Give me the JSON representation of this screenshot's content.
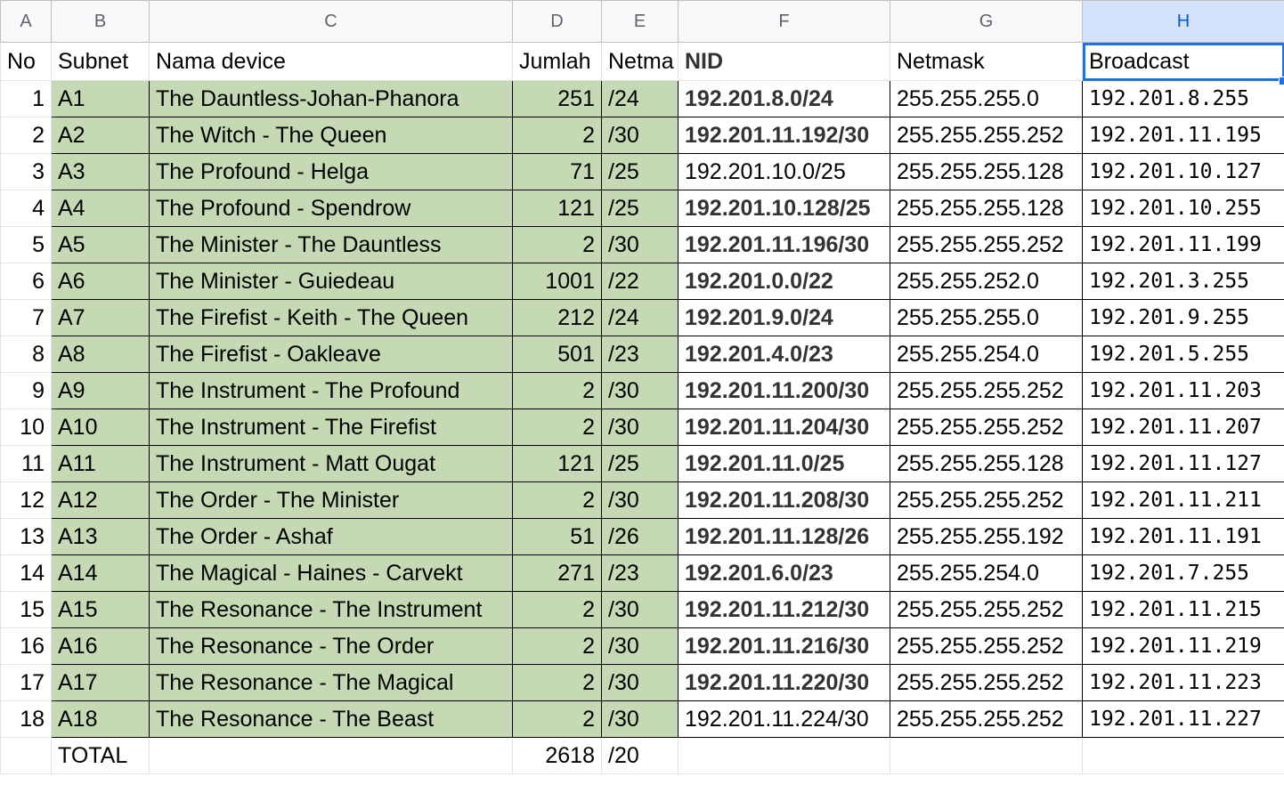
{
  "columns": [
    "A",
    "B",
    "C",
    "D",
    "E",
    "F",
    "G",
    "H"
  ],
  "header_row": {
    "no": "No",
    "subnet": "Subnet",
    "device": "Nama device",
    "jumlah": "Jumlah",
    "netmask_short": "Netma",
    "nid": "NID",
    "netmask": "Netmask",
    "broadcast": "Broadcast"
  },
  "rows": [
    {
      "no": "1",
      "subnet": "A1",
      "device": "The Dauntless-Johan-Phanora",
      "jumlah": "251",
      "prefix": "/24",
      "nid": "192.201.8.0/24",
      "netmask": "255.255.255.0",
      "broadcast": "192.201.8.255",
      "nid_bold": true
    },
    {
      "no": "2",
      "subnet": "A2",
      "device": "The Witch - The Queen",
      "jumlah": "2",
      "prefix": "/30",
      "nid": "192.201.11.192/30",
      "netmask": "255.255.255.252",
      "broadcast": "192.201.11.195",
      "nid_bold": true
    },
    {
      "no": "3",
      "subnet": "A3",
      "device": "The Profound - Helga",
      "jumlah": "71",
      "prefix": "/25",
      "nid": "192.201.10.0/25",
      "netmask": "255.255.255.128",
      "broadcast": "192.201.10.127",
      "nid_bold": false
    },
    {
      "no": "4",
      "subnet": "A4",
      "device": "The Profound - Spendrow",
      "jumlah": "121",
      "prefix": "/25",
      "nid": "192.201.10.128/25",
      "netmask": "255.255.255.128",
      "broadcast": "192.201.10.255",
      "nid_bold": true
    },
    {
      "no": "5",
      "subnet": "A5",
      "device": "The Minister - The Dauntless",
      "jumlah": "2",
      "prefix": "/30",
      "nid": "192.201.11.196/30",
      "netmask": "255.255.255.252",
      "broadcast": "192.201.11.199",
      "nid_bold": true
    },
    {
      "no": "6",
      "subnet": "A6",
      "device": "The Minister - Guiedeau",
      "jumlah": "1001",
      "prefix": "/22",
      "nid": "192.201.0.0/22",
      "netmask": "255.255.252.0",
      "broadcast": "192.201.3.255",
      "nid_bold": true
    },
    {
      "no": "7",
      "subnet": "A7",
      "device": "The Firefist - Keith - The Queen",
      "jumlah": "212",
      "prefix": "/24",
      "nid": "192.201.9.0/24",
      "netmask": "255.255.255.0",
      "broadcast": "192.201.9.255",
      "nid_bold": true
    },
    {
      "no": "8",
      "subnet": "A8",
      "device": "The Firefist - Oakleave",
      "jumlah": "501",
      "prefix": "/23",
      "nid": "192.201.4.0/23",
      "netmask": "255.255.254.0",
      "broadcast": "192.201.5.255",
      "nid_bold": true
    },
    {
      "no": "9",
      "subnet": "A9",
      "device": "The Instrument - The Profound",
      "jumlah": "2",
      "prefix": "/30",
      "nid": "192.201.11.200/30",
      "netmask": "255.255.255.252",
      "broadcast": "192.201.11.203",
      "nid_bold": true
    },
    {
      "no": "10",
      "subnet": "A10",
      "device": "The Instrument - The Firefist",
      "jumlah": "2",
      "prefix": "/30",
      "nid": "192.201.11.204/30",
      "netmask": "255.255.255.252",
      "broadcast": "192.201.11.207",
      "nid_bold": true
    },
    {
      "no": "11",
      "subnet": "A11",
      "device": "The Instrument - Matt Ougat",
      "jumlah": "121",
      "prefix": "/25",
      "nid": "192.201.11.0/25",
      "netmask": "255.255.255.128",
      "broadcast": "192.201.11.127",
      "nid_bold": true
    },
    {
      "no": "12",
      "subnet": "A12",
      "device": "The Order - The Minister",
      "jumlah": "2",
      "prefix": "/30",
      "nid": "192.201.11.208/30",
      "netmask": "255.255.255.252",
      "broadcast": "192.201.11.211",
      "nid_bold": true
    },
    {
      "no": "13",
      "subnet": "A13",
      "device": "The Order - Ashaf",
      "jumlah": "51",
      "prefix": "/26",
      "nid": "192.201.11.128/26",
      "netmask": "255.255.255.192",
      "broadcast": "192.201.11.191",
      "nid_bold": true
    },
    {
      "no": "14",
      "subnet": "A14",
      "device": "The Magical - Haines - Carvekt",
      "jumlah": "271",
      "prefix": "/23",
      "nid": "192.201.6.0/23",
      "netmask": "255.255.254.0",
      "broadcast": "192.201.7.255",
      "nid_bold": true
    },
    {
      "no": "15",
      "subnet": "A15",
      "device": "The Resonance - The Instrument",
      "jumlah": "2",
      "prefix": "/30",
      "nid": "192.201.11.212/30",
      "netmask": "255.255.255.252",
      "broadcast": "192.201.11.215",
      "nid_bold": true
    },
    {
      "no": "16",
      "subnet": "A16",
      "device": "The Resonance - The Order",
      "jumlah": "2",
      "prefix": "/30",
      "nid": "192.201.11.216/30",
      "netmask": "255.255.255.252",
      "broadcast": "192.201.11.219",
      "nid_bold": true
    },
    {
      "no": "17",
      "subnet": "A17",
      "device": "The Resonance - The Magical",
      "jumlah": "2",
      "prefix": "/30",
      "nid": "192.201.11.220/30",
      "netmask": "255.255.255.252",
      "broadcast": "192.201.11.223",
      "nid_bold": true
    },
    {
      "no": "18",
      "subnet": "A18",
      "device": "The Resonance - The Beast",
      "jumlah": "2",
      "prefix": "/30",
      "nid": "192.201.11.224/30",
      "netmask": "255.255.255.252",
      "broadcast": "192.201.11.227",
      "nid_bold": false
    }
  ],
  "total_row": {
    "label": "TOTAL",
    "jumlah": "2618",
    "prefix": "/20"
  },
  "colors": {
    "highlight": "#c5dab4",
    "selection": "#1a73e8"
  }
}
